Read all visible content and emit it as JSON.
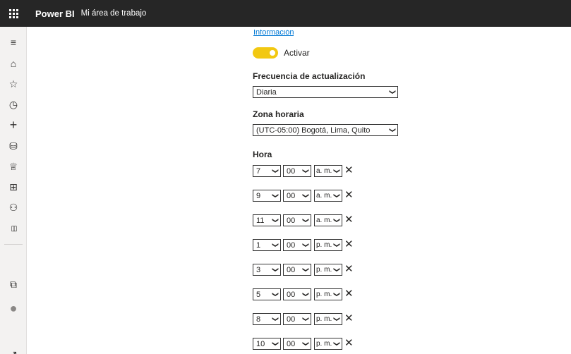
{
  "header": {
    "brand": "Power BI",
    "workspace": "Mi área de trabajo"
  },
  "sidebar": {
    "items": [
      {
        "name": "menu",
        "glyph": "≡"
      },
      {
        "name": "home",
        "glyph": "⌂"
      },
      {
        "name": "favorites",
        "glyph": "☆"
      },
      {
        "name": "recent",
        "glyph": "◷"
      },
      {
        "name": "create",
        "glyph": "+"
      },
      {
        "name": "datasets",
        "glyph": "⛁"
      },
      {
        "name": "goals",
        "glyph": "♕"
      },
      {
        "name": "apps",
        "glyph": "⊞"
      },
      {
        "name": "shared",
        "glyph": "⚇"
      },
      {
        "name": "learn",
        "glyph": "▯▯"
      },
      {
        "name": "workspaces",
        "glyph": "⧉"
      },
      {
        "name": "my-workspace",
        "glyph": "●"
      },
      {
        "name": "get-data",
        "glyph": "↗"
      }
    ]
  },
  "content": {
    "top_link": "Información",
    "toggle_label": "Activar",
    "frequency_label": "Frecuencia de actualización",
    "frequency_value": "Diaria",
    "timezone_label": "Zona horaria",
    "timezone_value": "(UTC-05:00) Bogotá, Lima, Quito",
    "time_label": "Hora",
    "times": [
      {
        "hour": "7",
        "minute": "00",
        "ampm": "a. m."
      },
      {
        "hour": "9",
        "minute": "00",
        "ampm": "a. m."
      },
      {
        "hour": "11",
        "minute": "00",
        "ampm": "a. m."
      },
      {
        "hour": "1",
        "minute": "00",
        "ampm": "p. m."
      },
      {
        "hour": "3",
        "minute": "00",
        "ampm": "p. m."
      },
      {
        "hour": "5",
        "minute": "00",
        "ampm": "p. m."
      },
      {
        "hour": "8",
        "minute": "00",
        "ampm": "p. m."
      },
      {
        "hour": "10",
        "minute": "00",
        "ampm": "p. m."
      }
    ],
    "remove_glyph": "✕",
    "chevron_glyph": "❯"
  },
  "colors": {
    "topbar": "#262626",
    "toggle_on": "#f2c811",
    "link": "#0078d4"
  }
}
